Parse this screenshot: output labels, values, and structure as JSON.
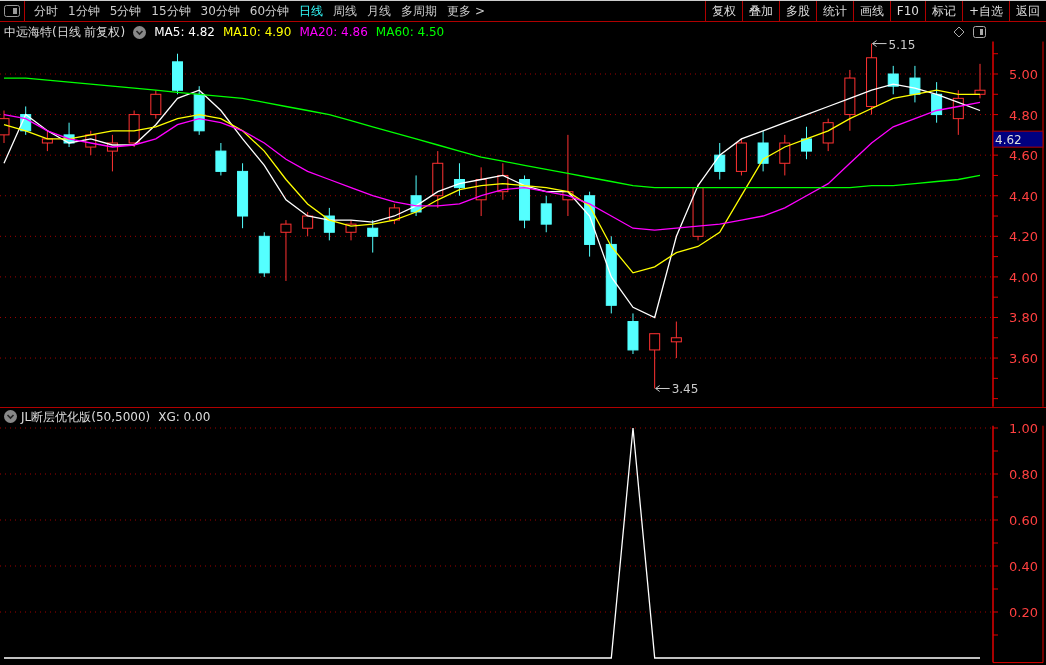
{
  "toolbar": {
    "tabs": [
      {
        "label": "分时",
        "selected": false
      },
      {
        "label": "1分钟",
        "selected": false
      },
      {
        "label": "5分钟",
        "selected": false
      },
      {
        "label": "15分钟",
        "selected": false
      },
      {
        "label": "30分钟",
        "selected": false
      },
      {
        "label": "60分钟",
        "selected": false
      },
      {
        "label": "日线",
        "selected": true
      },
      {
        "label": "周线",
        "selected": false
      },
      {
        "label": "月线",
        "selected": false
      },
      {
        "label": "多周期",
        "selected": false
      },
      {
        "label": "更多 >",
        "selected": false
      }
    ],
    "buttons": [
      "复权",
      "叠加",
      "多股",
      "统计",
      "画线",
      "F10",
      "标记",
      "+自选",
      "返回"
    ]
  },
  "main_chart": {
    "title": "中远海特(日线 前复权)",
    "legend": [
      "MA5: 4.82",
      "MA10: 4.90",
      "MA20: 4.86",
      "MA60: 4.50"
    ],
    "price_tag": "4.62",
    "chart_data": {
      "type": "candlestick",
      "ylim": [
        3.36,
        5.16
      ],
      "grid": true,
      "yticks": [
        {
          "value": 3.6,
          "label": "3.60"
        },
        {
          "value": 3.8,
          "label": "3.80"
        },
        {
          "value": 4.0,
          "label": "4.00"
        },
        {
          "value": 4.2,
          "label": "4.20"
        },
        {
          "value": 4.4,
          "label": "4.40"
        },
        {
          "value": 4.6,
          "label": "4.60"
        },
        {
          "value": 4.8,
          "label": "4.80"
        },
        {
          "value": 5.0,
          "label": "5.00"
        }
      ],
      "ohlc": [
        [
          4.7,
          4.82,
          4.66,
          4.78
        ],
        [
          4.8,
          4.84,
          4.7,
          4.72
        ],
        [
          4.66,
          4.72,
          4.62,
          4.68
        ],
        [
          4.7,
          4.76,
          4.64,
          4.66
        ],
        [
          4.64,
          4.72,
          4.6,
          4.7
        ],
        [
          4.62,
          4.7,
          4.52,
          4.66
        ],
        [
          4.66,
          4.82,
          4.64,
          4.8
        ],
        [
          4.8,
          4.92,
          4.78,
          4.9
        ],
        [
          5.06,
          5.1,
          4.9,
          4.92
        ],
        [
          4.9,
          4.94,
          4.7,
          4.72
        ],
        [
          4.62,
          4.66,
          4.5,
          4.52
        ],
        [
          4.52,
          4.56,
          4.24,
          4.3
        ],
        [
          4.2,
          4.22,
          4.0,
          4.02
        ],
        [
          4.22,
          4.28,
          3.98,
          4.26
        ],
        [
          4.24,
          4.32,
          4.2,
          4.3
        ],
        [
          4.3,
          4.34,
          4.18,
          4.22
        ],
        [
          4.22,
          4.28,
          4.18,
          4.26
        ],
        [
          4.24,
          4.28,
          4.12,
          4.2
        ],
        [
          4.28,
          4.36,
          4.26,
          4.34
        ],
        [
          4.4,
          4.5,
          4.3,
          4.32
        ],
        [
          4.4,
          4.62,
          4.34,
          4.56
        ],
        [
          4.48,
          4.56,
          4.4,
          4.44
        ],
        [
          4.38,
          4.54,
          4.3,
          4.48
        ],
        [
          4.42,
          4.56,
          4.38,
          4.5
        ],
        [
          4.48,
          4.5,
          4.24,
          4.28
        ],
        [
          4.36,
          4.4,
          4.22,
          4.26
        ],
        [
          4.38,
          4.7,
          4.3,
          4.42
        ],
        [
          4.4,
          4.42,
          4.1,
          4.16
        ],
        [
          4.16,
          4.2,
          3.82,
          3.86
        ],
        [
          3.78,
          3.82,
          3.62,
          3.64
        ],
        [
          3.64,
          3.72,
          3.45,
          3.72
        ],
        [
          3.68,
          3.78,
          3.6,
          3.7
        ],
        [
          4.2,
          4.46,
          4.18,
          4.44
        ],
        [
          4.6,
          4.66,
          4.48,
          4.52
        ],
        [
          4.52,
          4.68,
          4.5,
          4.66
        ],
        [
          4.66,
          4.72,
          4.52,
          4.56
        ],
        [
          4.56,
          4.7,
          4.5,
          4.66
        ],
        [
          4.68,
          4.74,
          4.58,
          4.62
        ],
        [
          4.66,
          4.78,
          4.62,
          4.76
        ],
        [
          4.8,
          5.02,
          4.72,
          4.98
        ],
        [
          4.84,
          5.15,
          4.8,
          5.08
        ],
        [
          5.0,
          5.04,
          4.9,
          4.94
        ],
        [
          4.98,
          5.04,
          4.86,
          4.9
        ],
        [
          4.9,
          4.96,
          4.76,
          4.8
        ],
        [
          4.78,
          4.92,
          4.7,
          4.88
        ],
        [
          4.9,
          5.05,
          4.88,
          4.92
        ]
      ],
      "series": [
        {
          "type": "line",
          "color": "#ffffff",
          "values": [
            4.56,
            4.8,
            4.72,
            4.66,
            4.68,
            4.65,
            4.65,
            4.75,
            4.88,
            4.92,
            4.82,
            4.68,
            4.55,
            4.38,
            4.3,
            4.28,
            4.28,
            4.27,
            4.3,
            4.35,
            4.42,
            4.46,
            4.48,
            4.5,
            4.45,
            4.42,
            4.42,
            4.3,
            4.0,
            3.85,
            3.8,
            4.2,
            4.45,
            4.6,
            4.68,
            4.72,
            4.76,
            4.8,
            4.84,
            4.88,
            4.92,
            4.95,
            4.93,
            4.9,
            4.86,
            4.82
          ]
        },
        {
          "type": "line",
          "color": "#ffff00",
          "values": [
            4.75,
            4.72,
            4.68,
            4.68,
            4.7,
            4.72,
            4.72,
            4.74,
            4.78,
            4.8,
            4.78,
            4.72,
            4.62,
            4.48,
            4.36,
            4.28,
            4.25,
            4.26,
            4.28,
            4.32,
            4.38,
            4.43,
            4.45,
            4.46,
            4.45,
            4.44,
            4.42,
            4.35,
            4.15,
            4.02,
            4.05,
            4.12,
            4.15,
            4.22,
            4.4,
            4.58,
            4.64,
            4.68,
            4.72,
            4.78,
            4.83,
            4.88,
            4.9,
            4.92,
            4.9,
            4.9
          ]
        },
        {
          "type": "line",
          "color": "#ff00ff",
          "values": [
            4.8,
            4.78,
            4.72,
            4.68,
            4.66,
            4.64,
            4.65,
            4.68,
            4.75,
            4.78,
            4.76,
            4.72,
            4.66,
            4.58,
            4.52,
            4.48,
            4.44,
            4.4,
            4.37,
            4.35,
            4.35,
            4.36,
            4.4,
            4.43,
            4.44,
            4.42,
            4.4,
            4.36,
            4.3,
            4.24,
            4.23,
            4.24,
            4.25,
            4.26,
            4.28,
            4.3,
            4.34,
            4.4,
            4.46,
            4.56,
            4.66,
            4.74,
            4.78,
            4.82,
            4.84,
            4.86
          ]
        },
        {
          "type": "line",
          "color": "#00ff00",
          "values": [
            4.98,
            4.98,
            4.97,
            4.96,
            4.95,
            4.94,
            4.93,
            4.92,
            4.91,
            4.9,
            4.89,
            4.88,
            4.86,
            4.84,
            4.82,
            4.8,
            4.77,
            4.74,
            4.71,
            4.68,
            4.65,
            4.62,
            4.59,
            4.57,
            4.55,
            4.53,
            4.51,
            4.49,
            4.47,
            4.45,
            4.44,
            4.44,
            4.44,
            4.44,
            4.44,
            4.44,
            4.44,
            4.44,
            4.44,
            4.44,
            4.45,
            4.45,
            4.46,
            4.47,
            4.48,
            4.5
          ]
        }
      ],
      "annotations": [
        "5.15",
        "3.45"
      ]
    }
  },
  "indicator_panel": {
    "title": "JL断层优化版(50,5000)",
    "reading": "XG: 0.00",
    "chart_data": {
      "type": "line",
      "ylim": [
        -0.02,
        1.01
      ],
      "grid": true,
      "yticks": [
        {
          "value": 0.2,
          "label": "0.20"
        },
        {
          "value": 0.4,
          "label": "0.40"
        },
        {
          "value": 0.6,
          "label": "0.60"
        },
        {
          "value": 0.8,
          "label": "0.80"
        },
        {
          "value": 1.0,
          "label": "1.00"
        }
      ],
      "series": [
        {
          "color": "#ffffff",
          "values": [
            0,
            0,
            0,
            0,
            0,
            0,
            0,
            0,
            0,
            0,
            0,
            0,
            0,
            0,
            0,
            0,
            0,
            0,
            0,
            0,
            0,
            0,
            0,
            0,
            0,
            0,
            0,
            0,
            0,
            1,
            0,
            0,
            0,
            0,
            0,
            0,
            0,
            0,
            0,
            0,
            0,
            0,
            0,
            0,
            0,
            0
          ]
        }
      ]
    }
  }
}
